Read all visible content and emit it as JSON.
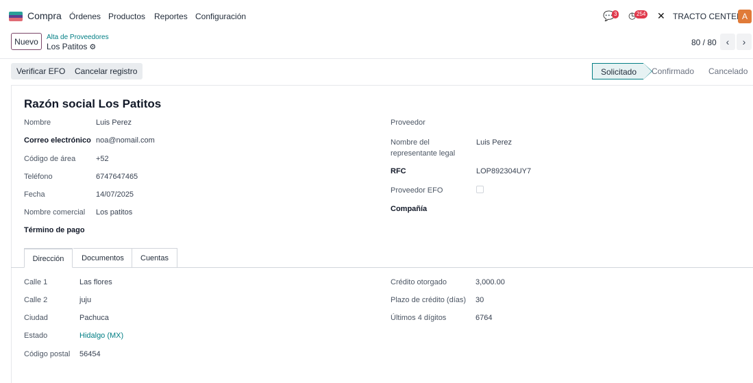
{
  "navbar": {
    "app_name": "Compra",
    "menu": [
      "Órdenes",
      "Productos",
      "Reportes",
      "Configuración"
    ],
    "chat_count": "3",
    "activity_count": "254",
    "company": "TRACTO CENTER",
    "avatar_letter": "A"
  },
  "control": {
    "new_label": "Nuevo",
    "breadcrumb_parent": "Alta de Proveedores",
    "record_name": "Los Patitos",
    "pager": "80 / 80"
  },
  "actions": {
    "verify": "Verificar EFO",
    "cancel": "Cancelar registro"
  },
  "stages": [
    "Solicitado",
    "Confirmado",
    "Cancelado"
  ],
  "form": {
    "title": "Razón social Los Patitos",
    "left": [
      {
        "label": "Nombre",
        "value": "Luis Perez"
      },
      {
        "label": "Correo electrónico",
        "value": "noa@nomail.com"
      },
      {
        "label": "Código de área",
        "value": "+52"
      },
      {
        "label": "Teléfono",
        "value": "6747647465"
      },
      {
        "label": "Fecha",
        "value": "14/07/2025"
      },
      {
        "label": "Nombre comercial",
        "value": "Los patitos"
      },
      {
        "label": "Término de pago",
        "value": ""
      }
    ],
    "right": [
      {
        "label": "Proveedor",
        "value": ""
      },
      {
        "label": "Nombre del",
        "label2": "representante legal",
        "value": "Luis Perez"
      },
      {
        "label": "RFC",
        "value": "LOP892304UY7"
      },
      {
        "label": "Proveedor EFO",
        "value": ""
      },
      {
        "label": "Compañía",
        "value": ""
      }
    ]
  },
  "tabs": [
    "Dirección",
    "Documentos",
    "Cuentas"
  ],
  "address": {
    "left": [
      {
        "label": "Calle 1",
        "value": "Las flores"
      },
      {
        "label": "Calle 2",
        "value": "juju"
      },
      {
        "label": "Ciudad",
        "value": "Pachuca"
      },
      {
        "label": "Estado",
        "value": "Hidalgo (MX)"
      },
      {
        "label": "Código postal",
        "value": "56454"
      }
    ],
    "right": [
      {
        "label": "Crédito otorgado",
        "value": "3,000.00"
      },
      {
        "label": "Plazo de crédito (días)",
        "value": "30"
      },
      {
        "label": "Últimos 4 dígitos",
        "value": "6764"
      }
    ]
  },
  "colors": {
    "accent": "#017e84",
    "brand": "#7b4669",
    "badge": "#e0384b",
    "avatar": "#e07b39"
  }
}
